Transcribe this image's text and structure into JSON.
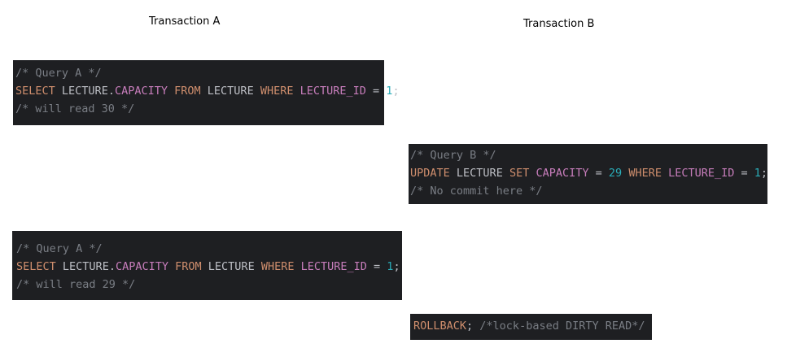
{
  "headings": {
    "transaction_a": "Transaction A",
    "transaction_b": "Transaction B"
  },
  "colors": {
    "background": "#1e1f22",
    "comment": "#7a7e85",
    "keyword": "#cf8e6d",
    "field": "#c77dbb",
    "identifier": "#bcbec4",
    "number": "#2aacb8"
  },
  "blocks": {
    "a1": [
      [
        {
          "t": "comment",
          "v": "/* Query A */"
        }
      ],
      [
        {
          "t": "keyword",
          "v": "SELECT"
        },
        {
          "t": "punct",
          "v": " "
        },
        {
          "t": "ident",
          "v": "LECTURE"
        },
        {
          "t": "punct",
          "v": "."
        },
        {
          "t": "field",
          "v": "CAPACITY"
        },
        {
          "t": "punct",
          "v": " "
        },
        {
          "t": "keyword",
          "v": "FROM"
        },
        {
          "t": "punct",
          "v": " "
        },
        {
          "t": "ident",
          "v": "LECTURE"
        },
        {
          "t": "punct",
          "v": " "
        },
        {
          "t": "keyword",
          "v": "WHERE"
        },
        {
          "t": "punct",
          "v": " "
        },
        {
          "t": "field",
          "v": "LECTURE_ID"
        },
        {
          "t": "punct",
          "v": " = "
        },
        {
          "t": "number",
          "v": "1"
        },
        {
          "t": "punct",
          "v": ";"
        }
      ],
      [
        {
          "t": "comment",
          "v": "/* will read 30 */"
        }
      ]
    ],
    "b1": [
      [
        {
          "t": "comment",
          "v": "/* Query B */"
        }
      ],
      [
        {
          "t": "keyword",
          "v": "UPDATE"
        },
        {
          "t": "punct",
          "v": " "
        },
        {
          "t": "ident",
          "v": "LECTURE"
        },
        {
          "t": "punct",
          "v": " "
        },
        {
          "t": "keyword",
          "v": "SET"
        },
        {
          "t": "punct",
          "v": " "
        },
        {
          "t": "field",
          "v": "CAPACITY"
        },
        {
          "t": "punct",
          "v": " = "
        },
        {
          "t": "number",
          "v": "29"
        },
        {
          "t": "punct",
          "v": " "
        },
        {
          "t": "keyword",
          "v": "WHERE"
        },
        {
          "t": "punct",
          "v": " "
        },
        {
          "t": "field",
          "v": "LECTURE_ID"
        },
        {
          "t": "punct",
          "v": " = "
        },
        {
          "t": "number",
          "v": "1"
        },
        {
          "t": "punct",
          "v": ";"
        }
      ],
      [
        {
          "t": "comment",
          "v": "/* No commit here */"
        }
      ]
    ],
    "a2": [
      [
        {
          "t": "comment",
          "v": "/* Query A */"
        }
      ],
      [
        {
          "t": "keyword",
          "v": "SELECT"
        },
        {
          "t": "punct",
          "v": " "
        },
        {
          "t": "ident",
          "v": "LECTURE"
        },
        {
          "t": "punct",
          "v": "."
        },
        {
          "t": "field",
          "v": "CAPACITY"
        },
        {
          "t": "punct",
          "v": " "
        },
        {
          "t": "keyword",
          "v": "FROM"
        },
        {
          "t": "punct",
          "v": " "
        },
        {
          "t": "ident",
          "v": "LECTURE"
        },
        {
          "t": "punct",
          "v": " "
        },
        {
          "t": "keyword",
          "v": "WHERE"
        },
        {
          "t": "punct",
          "v": " "
        },
        {
          "t": "field",
          "v": "LECTURE_ID"
        },
        {
          "t": "punct",
          "v": " = "
        },
        {
          "t": "number",
          "v": "1"
        },
        {
          "t": "punct",
          "v": ";"
        }
      ],
      [
        {
          "t": "comment",
          "v": "/* will read 29 */"
        }
      ]
    ],
    "b2": [
      [
        {
          "t": "keyword",
          "v": "ROLLBACK"
        },
        {
          "t": "punct",
          "v": "; "
        },
        {
          "t": "comment",
          "v": "/*lock-based DIRTY READ*/"
        }
      ]
    ]
  }
}
